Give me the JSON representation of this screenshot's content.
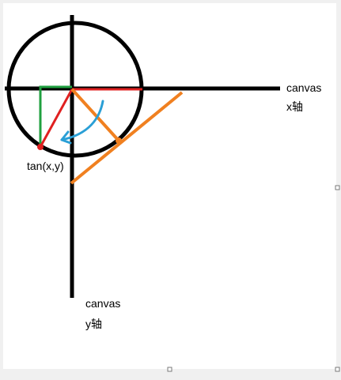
{
  "labels": {
    "x_axis_line1": "canvas",
    "x_axis_line2": "x轴",
    "y_axis_line1": "canvas",
    "y_axis_line2": "y轴",
    "tan_point": "tan(x,y)"
  },
  "colors": {
    "canvas_bg": "#ffffff",
    "window_bg": "#f0f0f0",
    "axis": "#000000",
    "circle": "#000000",
    "radius_line": "#e02020",
    "projection_line": "#20a040",
    "tangent_line": "#f08020",
    "rotation_arrow": "#2a9fd6",
    "point": "#e02020",
    "label_text": "#000000"
  }
}
